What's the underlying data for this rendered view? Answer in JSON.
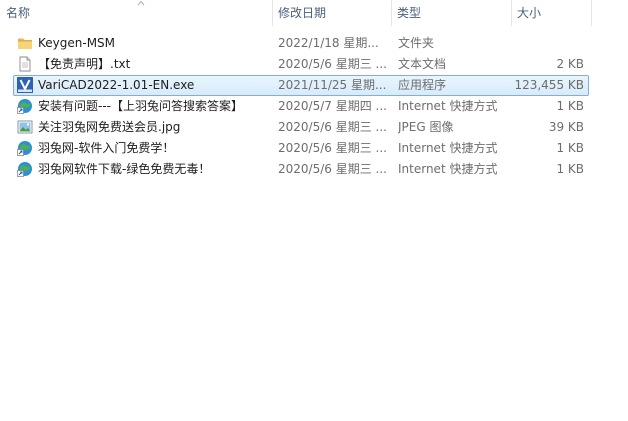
{
  "columns": {
    "name": "名称",
    "date": "修改日期",
    "type": "类型",
    "size": "大小"
  },
  "files": [
    {
      "name": "Keygen-MSM",
      "date": "2022/1/18 星期...",
      "type": "文件夹",
      "size": "",
      "icon": "folder-icon"
    },
    {
      "name": "【免责声明】.txt",
      "date": "2020/5/6 星期三 ...",
      "type": "文本文档",
      "size": "2 KB",
      "icon": "text-file-icon"
    },
    {
      "name": "VariCAD2022-1.01-EN.exe",
      "date": "2021/11/25 星期...",
      "type": "应用程序",
      "size": "123,455 KB",
      "icon": "varicad-app-icon"
    },
    {
      "name": "安装有问题---【上羽兔问答搜索答案】",
      "date": "2020/5/7 星期四 ...",
      "type": "Internet 快捷方式",
      "size": "1 KB",
      "icon": "internet-shortcut-icon"
    },
    {
      "name": "关注羽兔网免费送会员.jpg",
      "date": "2020/5/6 星期三 ...",
      "type": "JPEG 图像",
      "size": "39 KB",
      "icon": "image-file-icon"
    },
    {
      "name": "羽兔网-软件入门免费学！",
      "date": "2020/5/6 星期三 ...",
      "type": "Internet 快捷方式",
      "size": "1 KB",
      "icon": "internet-shortcut-icon"
    },
    {
      "name": "羽兔网软件下载-绿色免费无毒！",
      "date": "2020/5/6 星期三 ...",
      "type": "Internet 快捷方式",
      "size": "1 KB",
      "icon": "internet-shortcut-icon"
    }
  ],
  "selected_index": 2
}
